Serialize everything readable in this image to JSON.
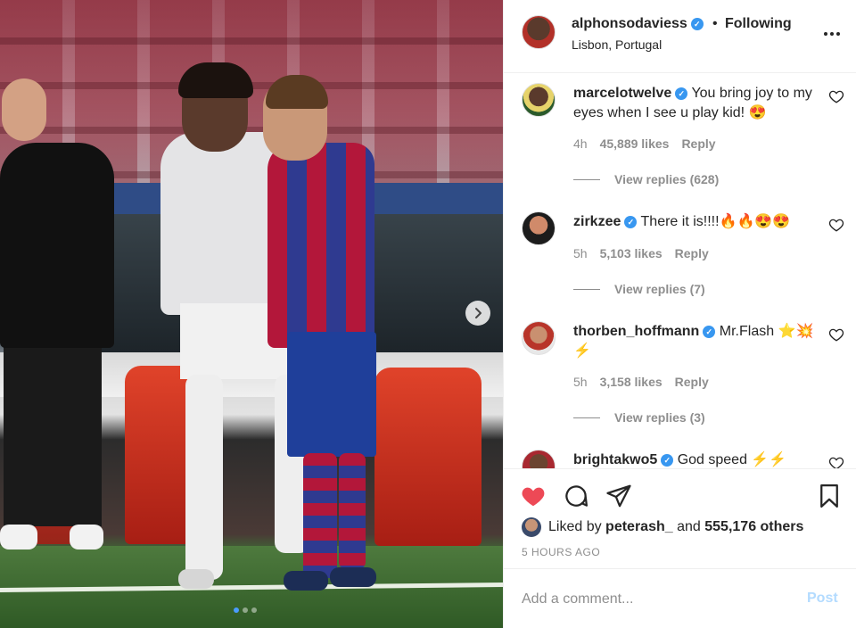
{
  "post": {
    "photo_alt_theme": "football match photo",
    "carousel": {
      "total": 3,
      "active_index": 0
    }
  },
  "header": {
    "username": "alphonsodaviess",
    "separator": "•",
    "follow_state": "Following",
    "location": "Lisbon, Portugal",
    "more_icon": "more-horizontal-icon"
  },
  "comments": [
    {
      "user": "marcelotwelve",
      "verified": true,
      "text": "You bring joy to my eyes when I see u play kid! 😍",
      "age": "4h",
      "likes": "45,889 likes",
      "reply_label": "Reply",
      "view_replies": "View replies (628)"
    },
    {
      "user": "zirkzee",
      "verified": true,
      "text": "There it is!!!!🔥🔥😍😍",
      "age": "5h",
      "likes": "5,103 likes",
      "reply_label": "Reply",
      "view_replies": "View replies (7)"
    },
    {
      "user": "thorben_hoffmann",
      "verified": true,
      "text": "Mr.Flash ⭐️💥⚡️",
      "age": "5h",
      "likes": "3,158 likes",
      "reply_label": "Reply",
      "view_replies": "View replies (3)"
    },
    {
      "user": "brightakwo5",
      "verified": true,
      "text": "God speed ⚡️⚡️"
    }
  ],
  "actions": {
    "liked_by_prefix": "Liked by",
    "liked_by_user": "peterash_",
    "liked_by_conjunction": "and",
    "liked_by_others": "555,176 others",
    "time_ago": "5 HOURS AGO",
    "heart_color": "#ed4956"
  },
  "add_comment": {
    "placeholder": "Add a comment...",
    "post_label": "Post",
    "post_color": "#b3dbff"
  },
  "colors": {
    "verified": "#3897f0",
    "text": "#262626",
    "secondary": "#8e8e8e"
  }
}
